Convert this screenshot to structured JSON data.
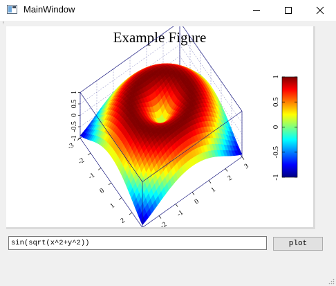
{
  "window": {
    "title": "MainWindow",
    "controls": {
      "minimize": "minimize-icon",
      "maximize": "maximize-icon",
      "close": "close-icon"
    }
  },
  "figure": {
    "title": "Example Figure"
  },
  "chart_data": {
    "type": "surface",
    "function": "sin(sqrt(x^2+y^2))",
    "x_ticks": [
      "-3",
      "-2",
      "-1",
      "0",
      "1",
      "2",
      "3"
    ],
    "y_ticks": [
      "-3",
      "-2",
      "-1",
      "0",
      "1",
      "2",
      "3"
    ],
    "z_ticks": [
      "-1",
      "-0.5",
      "0",
      "0.5",
      "1"
    ],
    "xlim": [
      -3,
      3
    ],
    "ylim": [
      -3,
      3
    ],
    "zlim": [
      -1,
      1
    ],
    "colorbar": {
      "ticks": [
        "1",
        "0.5",
        "0",
        "-0.5",
        "-1"
      ],
      "range": [
        -1,
        1
      ],
      "colormap": "jet"
    },
    "grid": true
  },
  "command": {
    "value": "sin(sqrt(x^2+y^2))"
  },
  "plot_button": {
    "label": "plot"
  }
}
